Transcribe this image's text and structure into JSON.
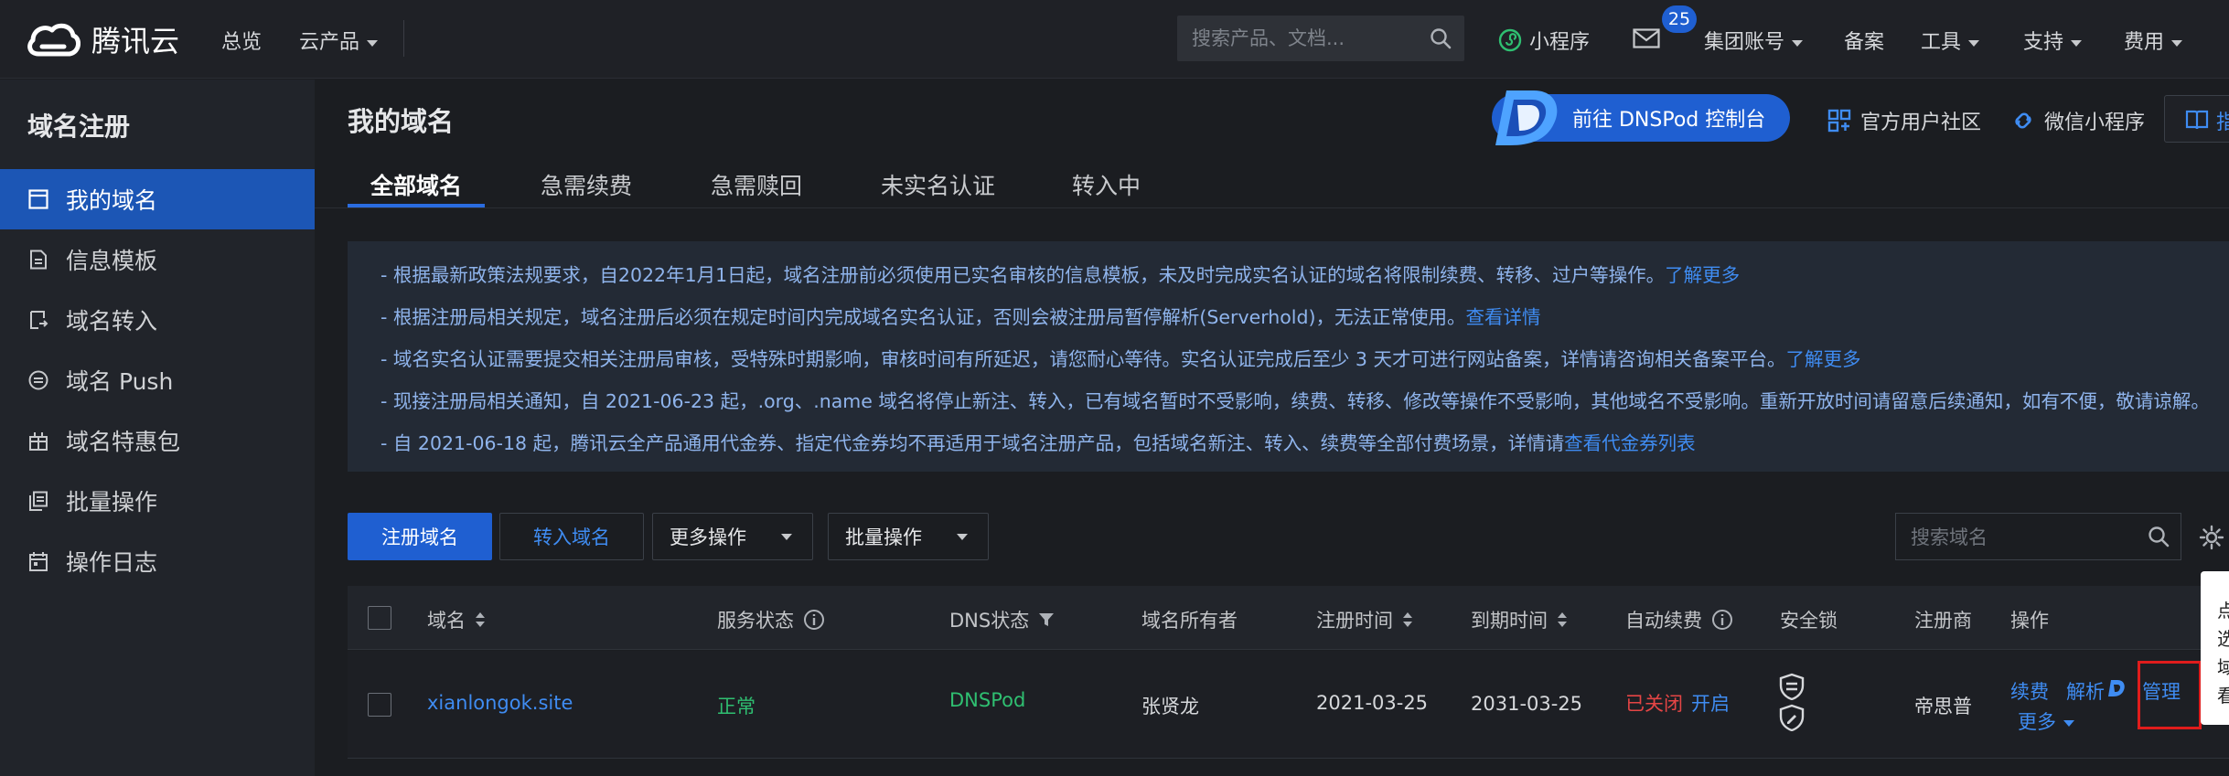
{
  "topbar": {
    "brand": "腾讯云",
    "nav": [
      "总览",
      "云产品"
    ],
    "search_placeholder": "搜索产品、文档...",
    "miniprogram": "小程序",
    "mail_badge": "25",
    "account": "集团账号",
    "beian": "备案",
    "tools": "工具",
    "support": "支持",
    "billing": "费用"
  },
  "sidebar": {
    "title": "域名注册",
    "items": [
      {
        "label": "我的域名",
        "icon": "browser-window-icon"
      },
      {
        "label": "信息模板",
        "icon": "document-icon"
      },
      {
        "label": "域名转入",
        "icon": "transfer-icon"
      },
      {
        "label": "域名 Push",
        "icon": "push-icon"
      },
      {
        "label": "域名特惠包",
        "icon": "gift-icon"
      },
      {
        "label": "批量操作",
        "icon": "copy-icon"
      },
      {
        "label": "操作日志",
        "icon": "calendar-icon"
      }
    ]
  },
  "header": {
    "title": "我的域名",
    "dnspod_button": "前往 DNSPod 控制台",
    "community": "官方用户社区",
    "wechat_mini": "微信小程序",
    "guide": "指"
  },
  "tabs": [
    "全部域名",
    "急需续费",
    "急需赎回",
    "未实名认证",
    "转入中"
  ],
  "notices": [
    {
      "text": "- 根据最新政策法规要求，自2022年1月1日起，域名注册前必须使用已实名审核的信息模板，未及时完成实名认证的域名将限制续费、转移、过户等操作。",
      "link": "了解更多"
    },
    {
      "text": "- 根据注册局相关规定，域名注册后必须在规定时间内完成域名实名认证，否则会被注册局暂停解析(Serverhold)，无法正常使用。",
      "link": "查看详情"
    },
    {
      "text": "- 域名实名认证需要提交相关注册局审核，受特殊时期影响，审核时间有所延迟，请您耐心等待。实名认证完成后至少 3 天才可进行网站备案，详情请咨询相关备案平台。",
      "link": "了解更多"
    },
    {
      "text": "- 现接注册局相关通知，自 2021-06-23 起，.org、.name 域名将停止新注、转入，已有域名暂时不受影响，续费、转移、修改等操作不受影响，其他域名不受影响。重新开放时间请留意后续通知，如有不便，敬请谅解。",
      "link": ""
    },
    {
      "text": "- 自 2021-06-18 起，腾讯云全产品通用代金券、指定代金券均不再适用于域名注册产品，包括域名新注、转入、续费等全部付费场景，详情请",
      "link": "查看代金券列表"
    }
  ],
  "toolbar": {
    "register": "注册域名",
    "transfer": "转入域名",
    "more_ops": "更多操作",
    "batch_ops": "批量操作",
    "search_placeholder": "搜索域名"
  },
  "table": {
    "columns": [
      "域名",
      "服务状态",
      "DNS状态",
      "域名所有者",
      "注册时间",
      "到期时间",
      "自动续费",
      "安全锁",
      "注册商",
      "操作"
    ],
    "rows": [
      {
        "domain": "xianlongok.site",
        "status": "正常",
        "dns": "DNSPod",
        "owner": "张贤龙",
        "registered": "2021-03-25",
        "expires": "2031-03-25",
        "auto_renew": "已关闭",
        "auto_renew_action": "开启",
        "registrar": "帝思普",
        "actions": {
          "renew": "续费",
          "resolve": "解析",
          "manage": "管理",
          "more": "更多"
        }
      }
    ]
  },
  "tooltip_edge": [
    "点",
    "选",
    "域",
    "看"
  ],
  "colors": {
    "accent": "#1f5fd1",
    "link": "#3f8cf2",
    "ok": "#2fbf71",
    "danger": "#e54545"
  }
}
